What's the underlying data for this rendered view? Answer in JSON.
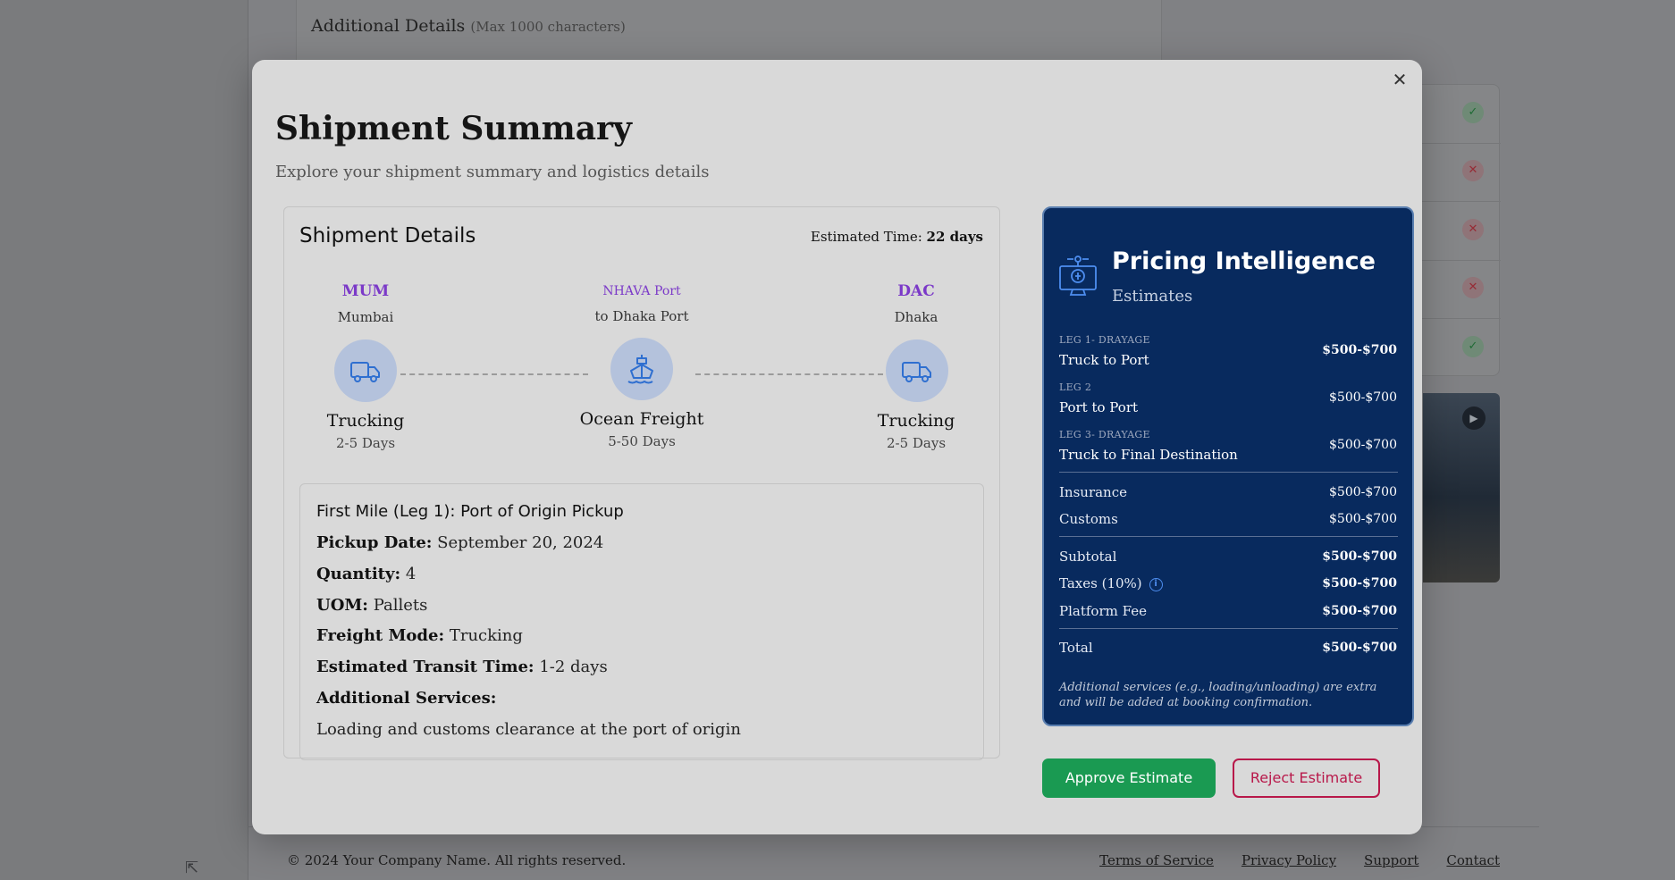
{
  "background": {
    "details_label": "Additional Details",
    "details_hint": "(Max 1000 characters)",
    "status_icons": [
      "check-icon",
      "x-icon",
      "x-icon",
      "x-icon",
      "check-icon"
    ],
    "footer": {
      "copyright": "© 2024 Your Company Name. All rights reserved.",
      "links": [
        "Terms of Service",
        "Privacy Policy",
        "Support",
        "Contact"
      ]
    }
  },
  "modal": {
    "title": "Shipment Summary",
    "subtitle": "Explore your shipment summary and logistics details",
    "close_icon": "close-icon"
  },
  "shipment": {
    "title": "Shipment Details",
    "estimated_time_label": "Estimated Time:",
    "estimated_time_value": "22 days",
    "route": {
      "origin": {
        "code": "MUM",
        "city": "Mumbai",
        "mode": "Trucking",
        "days": "2-5 Days",
        "icon": "truck-icon"
      },
      "middle": {
        "port": "NHAVA Port",
        "to": "to Dhaka Port",
        "mode": "Ocean Freight",
        "days": "5-50 Days",
        "icon": "ship-icon"
      },
      "destination": {
        "code": "DAC",
        "city": "Dhaka",
        "mode": "Trucking",
        "days": "2-5 Days",
        "icon": "truck-icon"
      }
    },
    "leg": {
      "heading": "First Mile (Leg 1): Port of Origin Pickup",
      "pickup_date_label": "Pickup Date:",
      "pickup_date": "September 20, 2024",
      "quantity_label": "Quantity:",
      "quantity": "4",
      "uom_label": "UOM:",
      "uom": "Pallets",
      "freight_mode_label": "Freight Mode:",
      "freight_mode": "Trucking",
      "transit_label": "Estimated Transit Time:",
      "transit": "1-2 days",
      "services_label": "Additional Services:",
      "services": "Loading and customs clearance at the port of origin"
    }
  },
  "pricing": {
    "title": "Pricing Intelligence",
    "subtitle": "Estimates",
    "icon": "pricing-intelligence-icon",
    "legs": [
      {
        "label": "LEG 1- DRAYAGE",
        "name": "Truck to Port",
        "amount": "$500-$700"
      },
      {
        "label": "LEG 2",
        "name": "Port to Port",
        "amount": "$500-$700"
      },
      {
        "label": "LEG 3- DRAYAGE",
        "name": "Truck to Final Destination",
        "amount": "$500-$700"
      }
    ],
    "extras": [
      {
        "label": "Insurance",
        "amount": "$500-$700"
      },
      {
        "label": "Customs",
        "amount": "$500-$700"
      }
    ],
    "subtotal": {
      "label": "Subtotal",
      "amount": "$500-$700"
    },
    "taxes": {
      "label": "Taxes (10%)",
      "amount": "$500-$700",
      "icon": "info-icon"
    },
    "platform_fee": {
      "label": "Platform Fee",
      "amount": "$500-$700"
    },
    "total": {
      "label": "Total",
      "amount": "$500-$700"
    },
    "note": "Additional services (e.g., loading/unloading) are extra and will be added at booking confirmation."
  },
  "actions": {
    "approve": "Approve Estimate",
    "reject": "Reject Estimate"
  },
  "colors": {
    "accent_purple": "#7b39c8",
    "pricing_bg": "#082a5e",
    "approve_green": "#1a9a52",
    "reject_red": "#b8184a"
  }
}
